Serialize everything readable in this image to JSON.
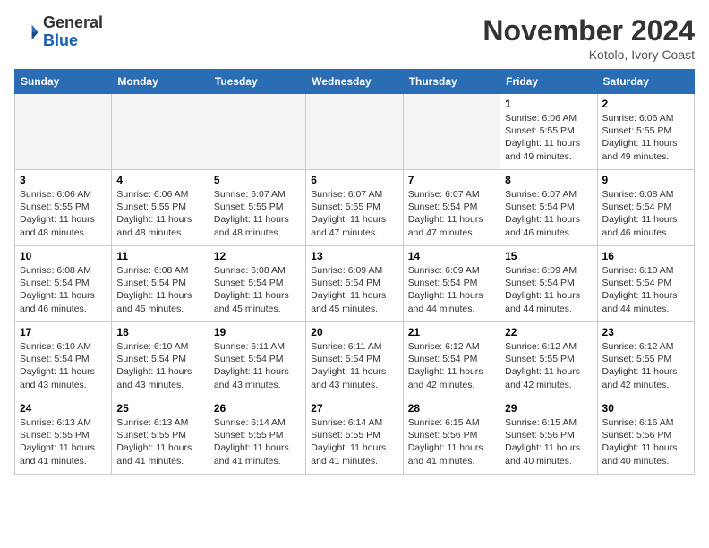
{
  "header": {
    "logo_general": "General",
    "logo_blue": "Blue",
    "month_title": "November 2024",
    "location": "Kotolo, Ivory Coast"
  },
  "weekdays": [
    "Sunday",
    "Monday",
    "Tuesday",
    "Wednesday",
    "Thursday",
    "Friday",
    "Saturday"
  ],
  "weeks": [
    [
      {
        "day": "",
        "info": ""
      },
      {
        "day": "",
        "info": ""
      },
      {
        "day": "",
        "info": ""
      },
      {
        "day": "",
        "info": ""
      },
      {
        "day": "",
        "info": ""
      },
      {
        "day": "1",
        "info": "Sunrise: 6:06 AM\nSunset: 5:55 PM\nDaylight: 11 hours and 49 minutes."
      },
      {
        "day": "2",
        "info": "Sunrise: 6:06 AM\nSunset: 5:55 PM\nDaylight: 11 hours and 49 minutes."
      }
    ],
    [
      {
        "day": "3",
        "info": "Sunrise: 6:06 AM\nSunset: 5:55 PM\nDaylight: 11 hours and 48 minutes."
      },
      {
        "day": "4",
        "info": "Sunrise: 6:06 AM\nSunset: 5:55 PM\nDaylight: 11 hours and 48 minutes."
      },
      {
        "day": "5",
        "info": "Sunrise: 6:07 AM\nSunset: 5:55 PM\nDaylight: 11 hours and 48 minutes."
      },
      {
        "day": "6",
        "info": "Sunrise: 6:07 AM\nSunset: 5:55 PM\nDaylight: 11 hours and 47 minutes."
      },
      {
        "day": "7",
        "info": "Sunrise: 6:07 AM\nSunset: 5:54 PM\nDaylight: 11 hours and 47 minutes."
      },
      {
        "day": "8",
        "info": "Sunrise: 6:07 AM\nSunset: 5:54 PM\nDaylight: 11 hours and 46 minutes."
      },
      {
        "day": "9",
        "info": "Sunrise: 6:08 AM\nSunset: 5:54 PM\nDaylight: 11 hours and 46 minutes."
      }
    ],
    [
      {
        "day": "10",
        "info": "Sunrise: 6:08 AM\nSunset: 5:54 PM\nDaylight: 11 hours and 46 minutes."
      },
      {
        "day": "11",
        "info": "Sunrise: 6:08 AM\nSunset: 5:54 PM\nDaylight: 11 hours and 45 minutes."
      },
      {
        "day": "12",
        "info": "Sunrise: 6:08 AM\nSunset: 5:54 PM\nDaylight: 11 hours and 45 minutes."
      },
      {
        "day": "13",
        "info": "Sunrise: 6:09 AM\nSunset: 5:54 PM\nDaylight: 11 hours and 45 minutes."
      },
      {
        "day": "14",
        "info": "Sunrise: 6:09 AM\nSunset: 5:54 PM\nDaylight: 11 hours and 44 minutes."
      },
      {
        "day": "15",
        "info": "Sunrise: 6:09 AM\nSunset: 5:54 PM\nDaylight: 11 hours and 44 minutes."
      },
      {
        "day": "16",
        "info": "Sunrise: 6:10 AM\nSunset: 5:54 PM\nDaylight: 11 hours and 44 minutes."
      }
    ],
    [
      {
        "day": "17",
        "info": "Sunrise: 6:10 AM\nSunset: 5:54 PM\nDaylight: 11 hours and 43 minutes."
      },
      {
        "day": "18",
        "info": "Sunrise: 6:10 AM\nSunset: 5:54 PM\nDaylight: 11 hours and 43 minutes."
      },
      {
        "day": "19",
        "info": "Sunrise: 6:11 AM\nSunset: 5:54 PM\nDaylight: 11 hours and 43 minutes."
      },
      {
        "day": "20",
        "info": "Sunrise: 6:11 AM\nSunset: 5:54 PM\nDaylight: 11 hours and 43 minutes."
      },
      {
        "day": "21",
        "info": "Sunrise: 6:12 AM\nSunset: 5:54 PM\nDaylight: 11 hours and 42 minutes."
      },
      {
        "day": "22",
        "info": "Sunrise: 6:12 AM\nSunset: 5:55 PM\nDaylight: 11 hours and 42 minutes."
      },
      {
        "day": "23",
        "info": "Sunrise: 6:12 AM\nSunset: 5:55 PM\nDaylight: 11 hours and 42 minutes."
      }
    ],
    [
      {
        "day": "24",
        "info": "Sunrise: 6:13 AM\nSunset: 5:55 PM\nDaylight: 11 hours and 41 minutes."
      },
      {
        "day": "25",
        "info": "Sunrise: 6:13 AM\nSunset: 5:55 PM\nDaylight: 11 hours and 41 minutes."
      },
      {
        "day": "26",
        "info": "Sunrise: 6:14 AM\nSunset: 5:55 PM\nDaylight: 11 hours and 41 minutes."
      },
      {
        "day": "27",
        "info": "Sunrise: 6:14 AM\nSunset: 5:55 PM\nDaylight: 11 hours and 41 minutes."
      },
      {
        "day": "28",
        "info": "Sunrise: 6:15 AM\nSunset: 5:56 PM\nDaylight: 11 hours and 41 minutes."
      },
      {
        "day": "29",
        "info": "Sunrise: 6:15 AM\nSunset: 5:56 PM\nDaylight: 11 hours and 40 minutes."
      },
      {
        "day": "30",
        "info": "Sunrise: 6:16 AM\nSunset: 5:56 PM\nDaylight: 11 hours and 40 minutes."
      }
    ]
  ]
}
